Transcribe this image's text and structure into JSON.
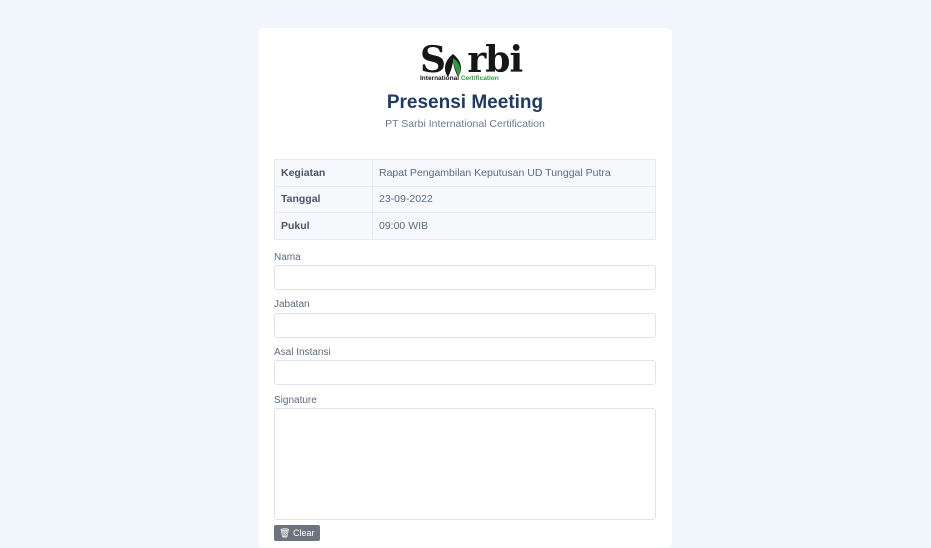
{
  "logo": {
    "word": "Sarbi",
    "sub_part1": "International",
    "sub_part2": "Certification",
    "colors": {
      "dark": "#161616",
      "green": "#2e9b3a"
    }
  },
  "header": {
    "title": "Presensi Meeting",
    "subtitle": "PT Sarbi International Certification"
  },
  "info": [
    {
      "key": "Kegiatan",
      "value": "Rapat Pengambilan Keputusan UD Tunggal Putra"
    },
    {
      "key": "Tanggal",
      "value": "23-09-2022"
    },
    {
      "key": "Pukul",
      "value": "09:00 WIB"
    }
  ],
  "form": {
    "nama_label": "Nama",
    "nama_value": "",
    "jabatan_label": "Jabatan",
    "jabatan_value": "",
    "instansi_label": "Asal Instansi",
    "instansi_value": "",
    "signature_label": "Signature",
    "clear_label": "Clear",
    "clear_icon": "trash-icon"
  },
  "colors": {
    "background": "#f1f6fd",
    "title": "#1e3a66",
    "clear_button": "#6c757d"
  }
}
